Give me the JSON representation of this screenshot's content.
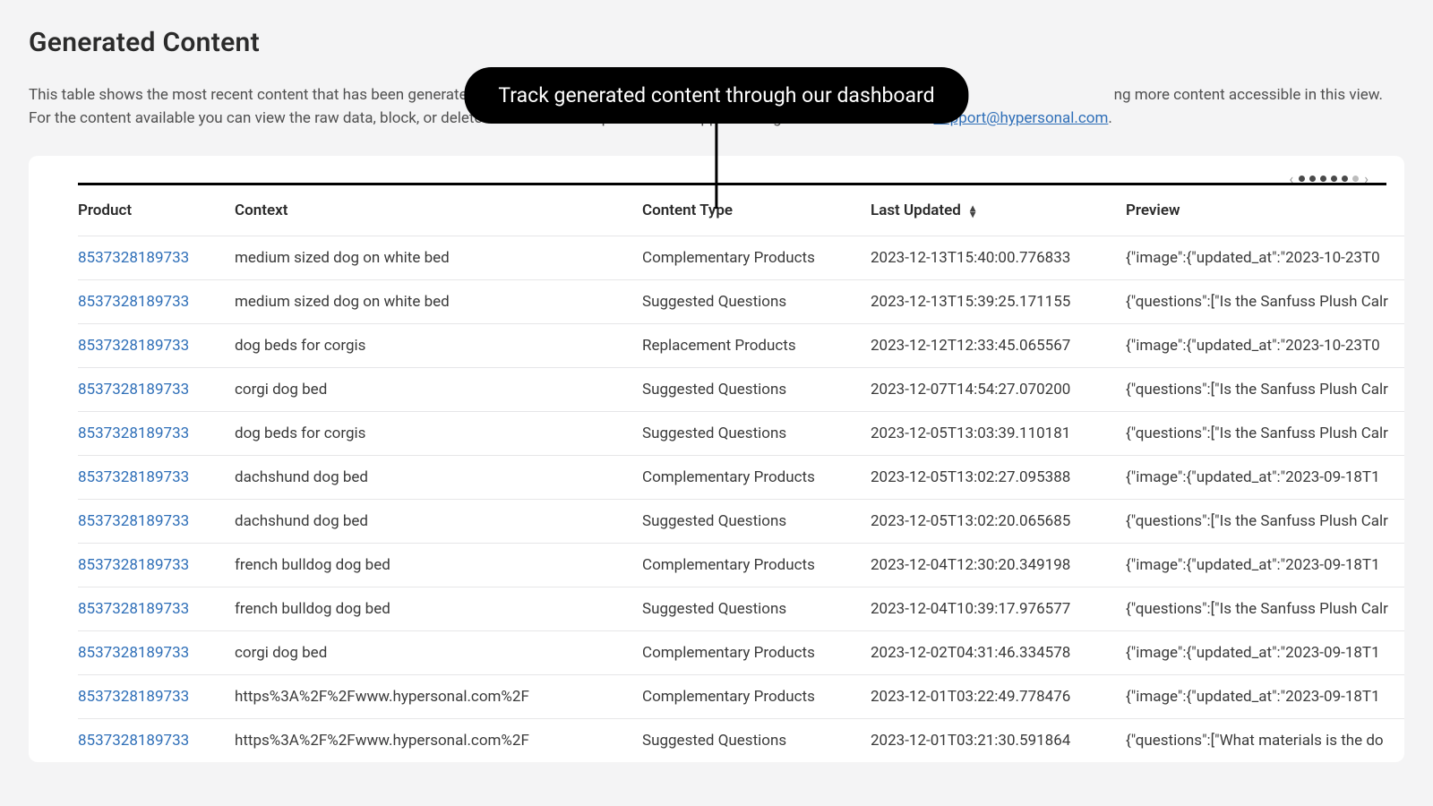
{
  "header": {
    "title": "Generated Content",
    "description_prefix": "This table shows the most recent content that has been generated by Hy",
    "description_middle": "ng more content accessible in this view. For the content available you can view the raw data, block, or delete the content. For questions or support with generated data contact ",
    "support_email": "support@hypersonal.com",
    "description_suffix": "."
  },
  "tooltip": {
    "text": "Track generated content through our dashboard"
  },
  "carousel": {
    "prev": "‹",
    "next": "›",
    "total_dots": 6,
    "active_count": 5
  },
  "table": {
    "columns": {
      "product": "Product",
      "context": "Context",
      "content_type": "Content Type",
      "last_updated": "Last Updated",
      "preview": "Preview"
    },
    "rows": [
      {
        "product": "8537328189733",
        "context": "medium sized dog on white bed",
        "type": "Complementary Products",
        "updated": "2023-12-13T15:40:00.776833",
        "preview": "{\"image\":{\"updated_at\":\"2023-10-23T0"
      },
      {
        "product": "8537328189733",
        "context": "medium sized dog on white bed",
        "type": "Suggested Questions",
        "updated": "2023-12-13T15:39:25.171155",
        "preview": "{\"questions\":[\"Is the Sanfuss Plush Calr"
      },
      {
        "product": "8537328189733",
        "context": "dog beds for corgis",
        "type": "Replacement Products",
        "updated": "2023-12-12T12:33:45.065567",
        "preview": "{\"image\":{\"updated_at\":\"2023-10-23T0"
      },
      {
        "product": "8537328189733",
        "context": "corgi dog bed",
        "type": "Suggested Questions",
        "updated": "2023-12-07T14:54:27.070200",
        "preview": "{\"questions\":[\"Is the Sanfuss Plush Calr"
      },
      {
        "product": "8537328189733",
        "context": "dog beds for corgis",
        "type": "Suggested Questions",
        "updated": "2023-12-05T13:03:39.110181",
        "preview": "{\"questions\":[\"Is the Sanfuss Plush Calr"
      },
      {
        "product": "8537328189733",
        "context": "dachshund dog bed",
        "type": "Complementary Products",
        "updated": "2023-12-05T13:02:27.095388",
        "preview": "{\"image\":{\"updated_at\":\"2023-09-18T1"
      },
      {
        "product": "8537328189733",
        "context": "dachshund dog bed",
        "type": "Suggested Questions",
        "updated": "2023-12-05T13:02:20.065685",
        "preview": "{\"questions\":[\"Is the Sanfuss Plush Calr"
      },
      {
        "product": "8537328189733",
        "context": "french bulldog dog bed",
        "type": "Complementary Products",
        "updated": "2023-12-04T12:30:20.349198",
        "preview": "{\"image\":{\"updated_at\":\"2023-09-18T1"
      },
      {
        "product": "8537328189733",
        "context": "french bulldog dog bed",
        "type": "Suggested Questions",
        "updated": "2023-12-04T10:39:17.976577",
        "preview": "{\"questions\":[\"Is the Sanfuss Plush Calr"
      },
      {
        "product": "8537328189733",
        "context": "corgi dog bed",
        "type": "Complementary Products",
        "updated": "2023-12-02T04:31:46.334578",
        "preview": "{\"image\":{\"updated_at\":\"2023-09-18T1"
      },
      {
        "product": "8537328189733",
        "context": "https%3A%2F%2Fwww.hypersonal.com%2F",
        "type": "Complementary Products",
        "updated": "2023-12-01T03:22:49.778476",
        "preview": "{\"image\":{\"updated_at\":\"2023-09-18T1"
      },
      {
        "product": "8537328189733",
        "context": "https%3A%2F%2Fwww.hypersonal.com%2F",
        "type": "Suggested Questions",
        "updated": "2023-12-01T03:21:30.591864",
        "preview": "{\"questions\":[\"What materials is the do"
      }
    ]
  }
}
